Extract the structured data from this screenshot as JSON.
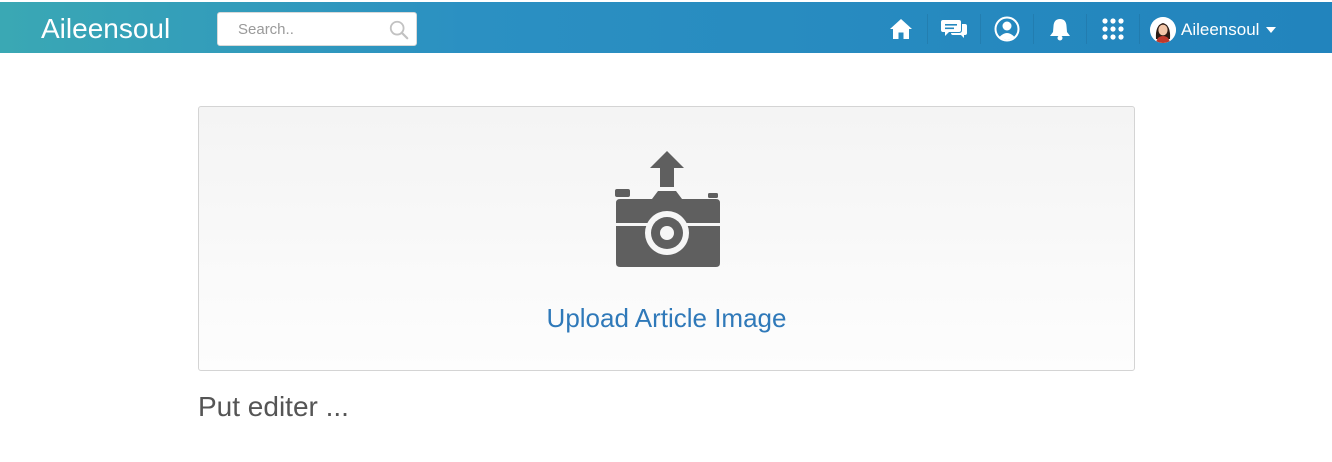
{
  "header": {
    "brand": "Aileensoul",
    "search": {
      "placeholder": "Search..",
      "value": ""
    },
    "icons": [
      "home-icon",
      "messages-icon",
      "profile-icon",
      "notifications-icon",
      "apps-grid-icon"
    ],
    "user": {
      "name": "Aileensoul"
    }
  },
  "upload": {
    "label": "Upload Article Image",
    "icon": "camera-upload-icon",
    "label_color": "#2f79b9"
  },
  "editor": {
    "placeholder": "Put editer ..."
  },
  "colors": {
    "header_start": "#3aa8b4",
    "header_end": "#2284bd",
    "icon_gray": "#5f5f5f"
  }
}
